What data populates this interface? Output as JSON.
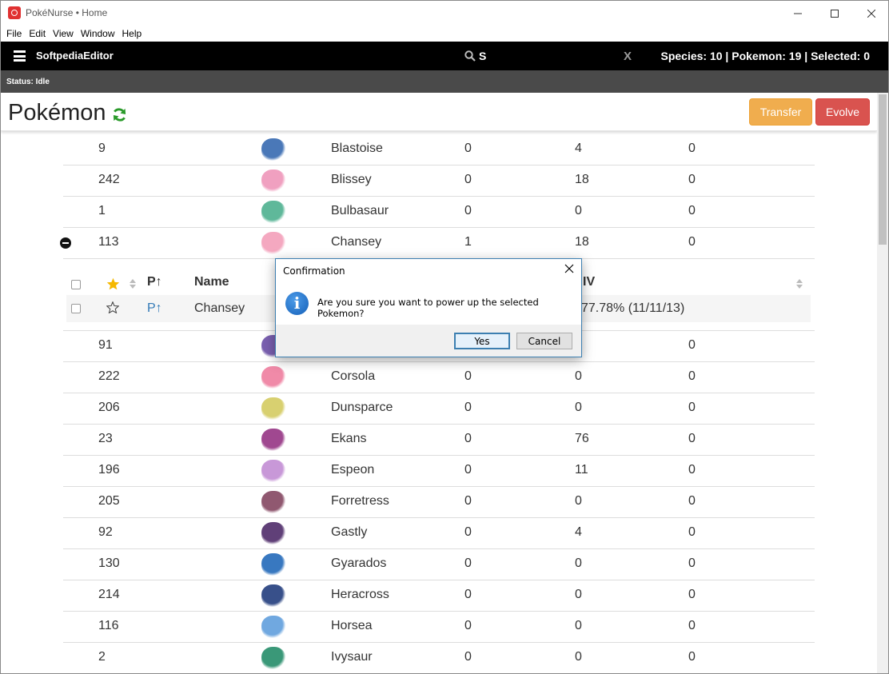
{
  "window": {
    "title": "PokéNurse • Home"
  },
  "menu": [
    "File",
    "Edit",
    "View",
    "Window",
    "Help"
  ],
  "navbar": {
    "brand": "SoftpediaEditor",
    "search_value": "S",
    "clear_label": "X",
    "counts": "Species: 10 | Pokemon: 19 | Selected: 0"
  },
  "status": "Status: Idle",
  "page": {
    "title": "Pokémon",
    "transfer_label": "Transfer",
    "evolve_label": "Evolve"
  },
  "species_rows_top": [
    {
      "id": "9",
      "name": "Blastoise",
      "a": "0",
      "b": "4",
      "c": "0",
      "color": "#4a78b8"
    },
    {
      "id": "242",
      "name": "Blissey",
      "a": "0",
      "b": "18",
      "c": "0",
      "color": "#f0a0c0"
    },
    {
      "id": "1",
      "name": "Bulbasaur",
      "a": "0",
      "b": "0",
      "c": "0",
      "color": "#5fb89a"
    },
    {
      "id": "113",
      "name": "Chansey",
      "a": "1",
      "b": "18",
      "c": "0",
      "color": "#f4a8c0"
    }
  ],
  "subtable": {
    "header": {
      "p": "P↑",
      "name": "Name",
      "iv": "IV"
    },
    "row": {
      "p": "P↑",
      "name": "Chansey",
      "iv": "77.78% (11/11/13)"
    }
  },
  "species_rows_bottom": [
    {
      "id": "91",
      "name": "",
      "a": "",
      "b": "",
      "c": "0",
      "color": "#7a60b0"
    },
    {
      "id": "222",
      "name": "Corsola",
      "a": "0",
      "b": "0",
      "c": "0",
      "color": "#f08aa8"
    },
    {
      "id": "206",
      "name": "Dunsparce",
      "a": "0",
      "b": "0",
      "c": "0",
      "color": "#d8d070"
    },
    {
      "id": "23",
      "name": "Ekans",
      "a": "0",
      "b": "76",
      "c": "0",
      "color": "#a04890"
    },
    {
      "id": "196",
      "name": "Espeon",
      "a": "0",
      "b": "11",
      "c": "0",
      "color": "#c898d8"
    },
    {
      "id": "205",
      "name": "Forretress",
      "a": "0",
      "b": "0",
      "c": "0",
      "color": "#905870"
    },
    {
      "id": "92",
      "name": "Gastly",
      "a": "0",
      "b": "4",
      "c": "0",
      "color": "#604078"
    },
    {
      "id": "130",
      "name": "Gyarados",
      "a": "0",
      "b": "0",
      "c": "0",
      "color": "#3878c0"
    },
    {
      "id": "214",
      "name": "Heracross",
      "a": "0",
      "b": "0",
      "c": "0",
      "color": "#38508a"
    },
    {
      "id": "116",
      "name": "Horsea",
      "a": "0",
      "b": "0",
      "c": "0",
      "color": "#70a8e0"
    },
    {
      "id": "2",
      "name": "Ivysaur",
      "a": "0",
      "b": "0",
      "c": "0",
      "color": "#3a9878"
    }
  ],
  "dialog": {
    "title": "Confirmation",
    "message": "Are you sure you want to power up the selected Pokemon?",
    "yes_label": "Yes",
    "cancel_label": "Cancel"
  }
}
